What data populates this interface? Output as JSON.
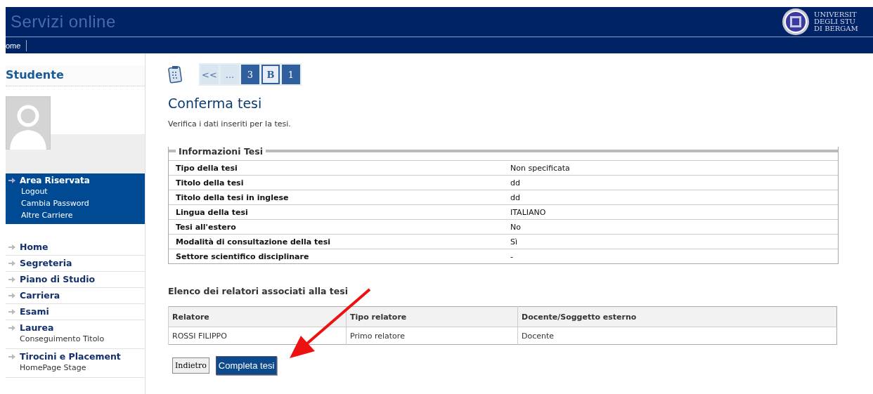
{
  "header": {
    "title": "Servizi online",
    "logo_lines": [
      "UNIVERSIT",
      "DEGLI STU",
      "DI BERGAM"
    ]
  },
  "navbar": {
    "items": [
      "ome"
    ]
  },
  "sidebar": {
    "title": "Studente",
    "reserved": {
      "label": "Area Riservata",
      "links": [
        "Logout",
        "Cambia Password",
        "Altre Carriere"
      ]
    },
    "items": [
      {
        "label": "Home"
      },
      {
        "label": "Segreteria"
      },
      {
        "label": "Piano di Studio"
      },
      {
        "label": "Carriera"
      },
      {
        "label": "Esami"
      },
      {
        "label": "Laurea",
        "children": [
          "Conseguimento Titolo"
        ]
      },
      {
        "label": "Tirocini e Placement",
        "children": [
          "HomePage Stage"
        ]
      }
    ]
  },
  "steps": [
    {
      "label": "<<",
      "kind": "nav",
      "selected": false
    },
    {
      "label": "...",
      "kind": "nav",
      "selected": false
    },
    {
      "label": "3",
      "kind": "step",
      "selected": false
    },
    {
      "label": "B",
      "kind": "step",
      "selected": true
    },
    {
      "label": "1",
      "kind": "step",
      "selected": false
    }
  ],
  "page": {
    "title": "Conferma tesi",
    "subtitle": "Verifica i dati inseriti per la tesi."
  },
  "info": {
    "legend": "Informazioni Tesi",
    "rows": [
      {
        "label": "Tipo della tesi",
        "value": "Non specificata"
      },
      {
        "label": "Titolo della tesi",
        "value": "dd"
      },
      {
        "label": "Titolo della tesi in inglese",
        "value": "dd"
      },
      {
        "label": "Lingua della tesi",
        "value": "ITALIANO"
      },
      {
        "label": "Tesi all'estero",
        "value": "No"
      },
      {
        "label": "Modalità di consultazione della tesi",
        "value": "Sì"
      },
      {
        "label": "Settore scientifico disciplinare",
        "value": "-"
      }
    ]
  },
  "supervisors": {
    "title": "Elenco dei relatori associati alla tesi",
    "columns": [
      "Relatore",
      "Tipo relatore",
      "Docente/Soggetto esterno"
    ],
    "rows": [
      [
        "ROSSI FILIPPO",
        "Primo relatore",
        "Docente"
      ]
    ]
  },
  "buttons": [
    {
      "label": "Indietro",
      "kind": "secondary"
    },
    {
      "label": "Completa tesi",
      "kind": "primary"
    }
  ]
}
